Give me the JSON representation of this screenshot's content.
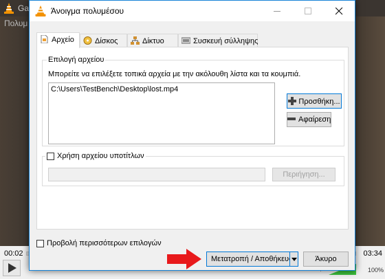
{
  "background": {
    "title": "Ga",
    "menu_first": "Πολυμ",
    "time_elapsed": "00:02",
    "time_total": "03:34",
    "volume_pct": "100%"
  },
  "dialog": {
    "title": "Άνοιγμα πολυμέσου",
    "tabs": [
      {
        "label": "Αρχείο",
        "icon": "file-icon",
        "active": true
      },
      {
        "label": "Δίσκος",
        "icon": "disc-icon",
        "active": false
      },
      {
        "label": "Δίκτυο",
        "icon": "network-icon",
        "active": false
      },
      {
        "label": "Συσκευή σύλληψης",
        "icon": "capture-device-icon",
        "active": false
      }
    ],
    "file_group": {
      "legend": "Επιλογή αρχείου",
      "hint": "Μπορείτε να επιλέξετε τοπικά αρχεία με την ακόλουθη λίστα και τα κουμπιά.",
      "files": [
        "C:\\Users\\TestBench\\Desktop\\lost.mp4"
      ],
      "add_label": "Προσθήκη...",
      "remove_label": "Αφαίρεση"
    },
    "subtitle_group": {
      "checkbox_label": "Χρήση αρχείου υποτίτλων",
      "checked": false,
      "input_value": "",
      "browse_label": "Περιήγηση..."
    },
    "more_options_label": "Προβολή περισσότερων επιλογών",
    "convert_label": "Μετατροπή / Αποθήκευση",
    "cancel_label": "Άκυρο"
  },
  "colors": {
    "accent": "#0078d7",
    "arrow": "#e8191b",
    "vlc_orange": "#f39200"
  }
}
